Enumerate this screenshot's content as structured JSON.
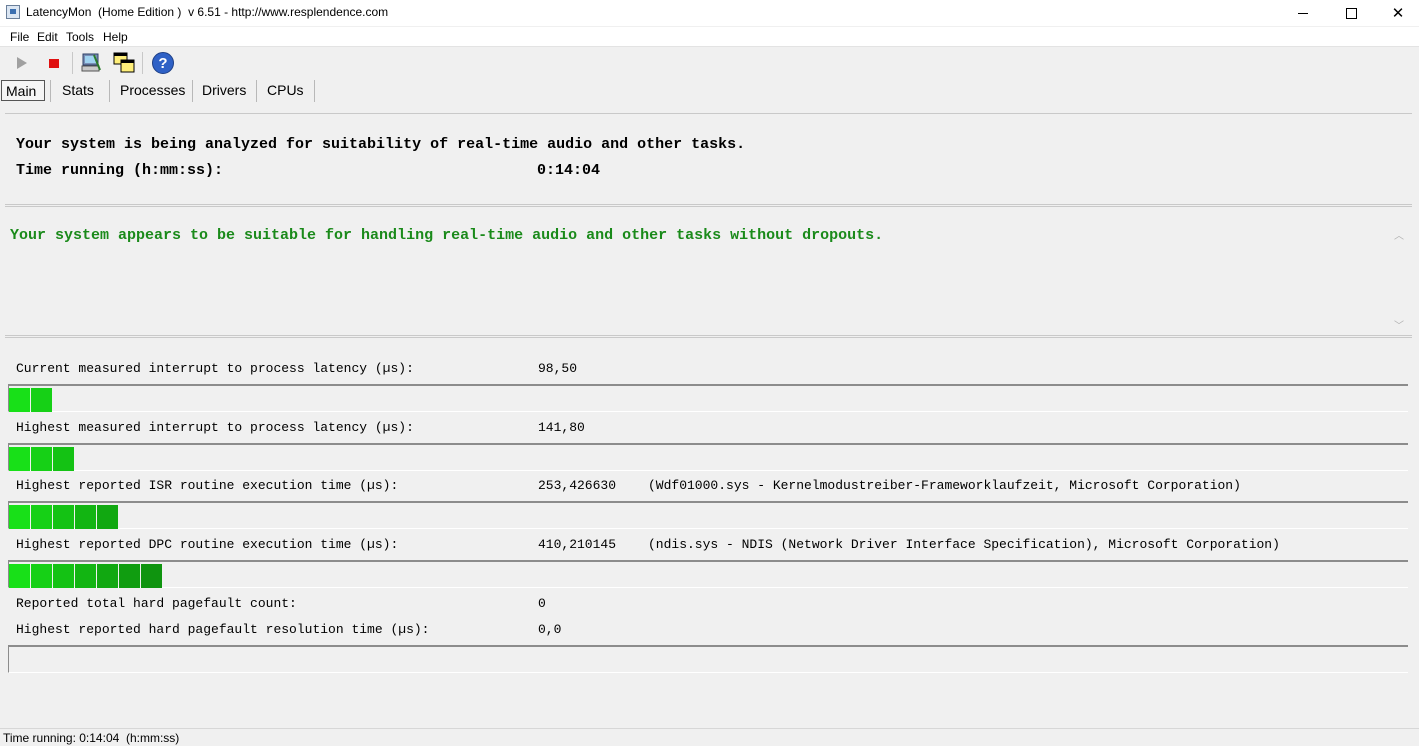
{
  "window": {
    "title": "LatencyMon  (Home Edition )  v 6.51 - http://www.resplendence.com",
    "minimize": "",
    "maximize": "",
    "close": "✕"
  },
  "menu": [
    "File",
    "Edit",
    "Tools",
    "Help"
  ],
  "toolbar": {
    "icons": [
      "play-icon",
      "stop-icon",
      "drivers-icon",
      "windows-icon",
      "help-icon"
    ],
    "help_glyph": "?"
  },
  "tabs": [
    {
      "label": "Main",
      "active": true
    },
    {
      "label": "Stats",
      "active": false
    },
    {
      "label": "Processes",
      "active": false
    },
    {
      "label": "Drivers",
      "active": false
    },
    {
      "label": "CPUs",
      "active": false
    }
  ],
  "main": {
    "analyzing": "Your system is being analyzed for suitability of real-time audio and other tasks.",
    "time_label": "Time running (h:mm:ss):",
    "time_value": "0:14:04",
    "verdict": "Your system appears to be suitable for handling real-time audio and other tasks without dropouts.",
    "verdict_color": "#1a8a1a",
    "metrics": [
      {
        "label": "Current measured interrupt to process latency (µs):",
        "value": "98,50",
        "extra": "",
        "segments": 2
      },
      {
        "label": "Highest measured interrupt to process latency (µs):",
        "value": "141,80",
        "extra": "",
        "segments": 3
      },
      {
        "label": "Highest reported ISR routine execution time (µs):",
        "value": "253,426630",
        "extra": "(Wdf01000.sys - Kernelmodustreiber-Frameworklaufzeit, Microsoft Corporation)",
        "segments": 5
      },
      {
        "label": "Highest reported DPC routine execution time (µs):",
        "value": "410,210145",
        "extra": "(ndis.sys - NDIS (Network Driver Interface Specification), Microsoft Corporation)",
        "segments": 7
      }
    ],
    "pagefault_count_label": "Reported total hard pagefault count:",
    "pagefault_count_value": "0",
    "pagefault_time_label": "Highest reported hard pagefault resolution time (µs):",
    "pagefault_time_value": "0,0",
    "pagefault_segments": 0
  },
  "status": "Time running: 0:14:04  (h:mm:ss)"
}
